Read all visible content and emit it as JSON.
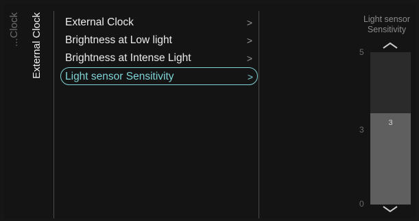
{
  "breadcrumb": {
    "previous": "...Clock",
    "current": "External Clock"
  },
  "menu": {
    "items": [
      {
        "label": "External Clock",
        "chevron": ">"
      },
      {
        "label": "Brightness at Low light",
        "chevron": ">"
      },
      {
        "label": "Brightness at Intense Light",
        "chevron": ">"
      },
      {
        "label": "Light sensor Sensitivity",
        "chevron": ">"
      }
    ],
    "selected_index": 3
  },
  "slider": {
    "title_line1": "Light sensor",
    "title_line2": "Sensitivity",
    "max": 5,
    "min": 0,
    "value": 3,
    "max_label": "5",
    "mid_label": "3",
    "min_label": "0",
    "value_label": "3",
    "up_icon": "chevron-up-icon",
    "down_icon": "chevron-down-icon"
  },
  "colors": {
    "accent": "#7fd3d6",
    "background": "#141414",
    "track": "#2b2b2b",
    "fill": "#5f5f5f"
  }
}
